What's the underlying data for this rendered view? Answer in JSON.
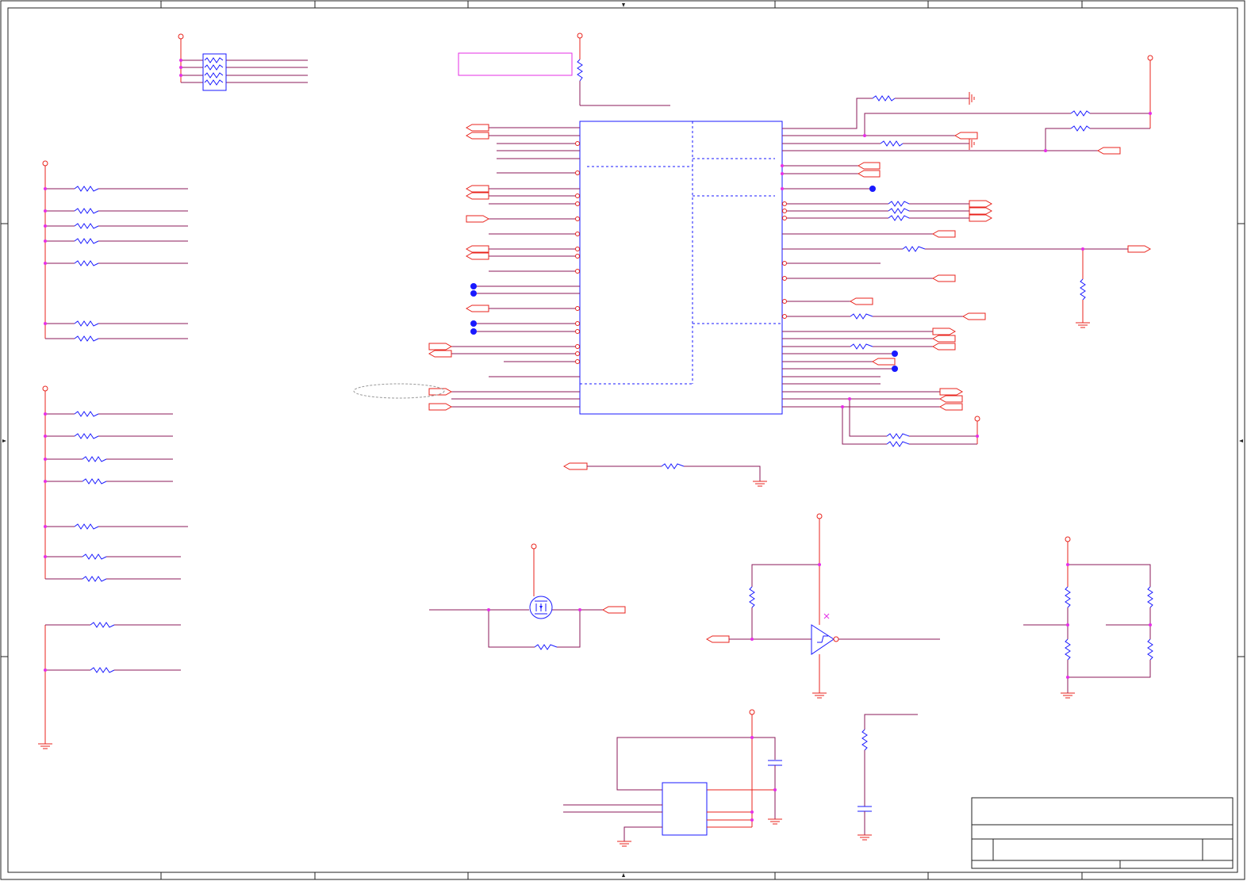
{
  "title_block": {
    "title": "",
    "size_label": "",
    "document_number": "",
    "revision": "",
    "date": "",
    "sheet": ""
  },
  "colors": {
    "wire": "#e8231c",
    "part": "#1a1aff",
    "junction": "#e62ee6",
    "label_box": "#e62ee6",
    "frame": "#222222",
    "signal_net": "#8b1a5a"
  }
}
